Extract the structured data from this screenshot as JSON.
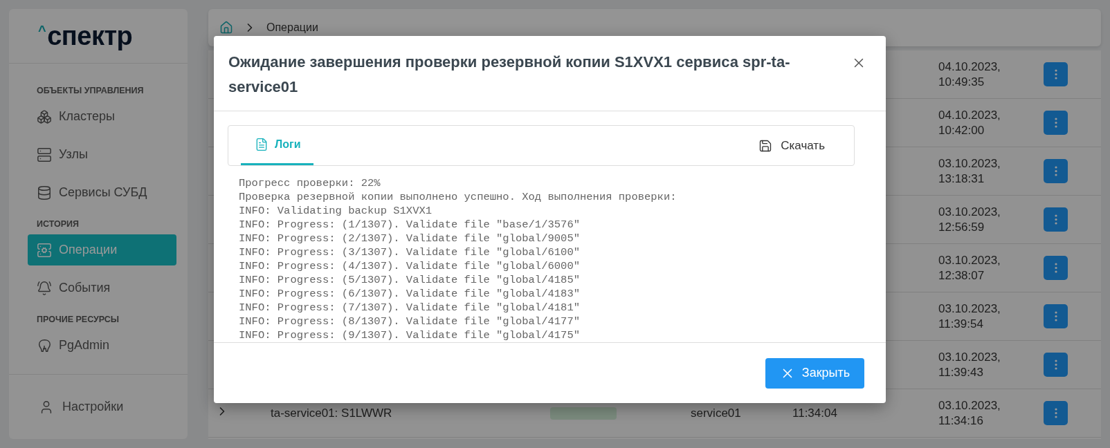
{
  "logo": {
    "mark": "^",
    "name": "спектр"
  },
  "sidebar": {
    "sections": [
      {
        "title": "ОБЪЕКТЫ УПРАВЛЕНИЯ",
        "items": [
          {
            "label": "Кластеры",
            "selected": false
          },
          {
            "label": "Узлы",
            "selected": false
          },
          {
            "label": "Сервисы СУБД",
            "selected": false
          }
        ]
      },
      {
        "title": "ИСТОРИЯ",
        "items": [
          {
            "label": "Операции",
            "selected": true
          },
          {
            "label": "События",
            "selected": false
          }
        ]
      },
      {
        "title": "ПРОЧИЕ РЕСУРСЫ",
        "items": [
          {
            "label": "PgAdmin",
            "selected": false
          }
        ]
      }
    ],
    "footer": {
      "label": "Настройки"
    }
  },
  "breadcrumb": {
    "items": [
      "Операции"
    ]
  },
  "table": {
    "rows": [
      {
        "kind": "partial",
        "date": "04.10.2023, 10:49:35"
      },
      {
        "kind": "partial",
        "date": "04.10.2023, 10:42:00"
      },
      {
        "kind": "partial",
        "date": "03.10.2023, 13:18:31"
      },
      {
        "kind": "partial",
        "date": "03.10.2023, 12:56:59"
      },
      {
        "kind": "partial",
        "date": "03.10.2023, 12:38:07"
      },
      {
        "kind": "partial",
        "date": "03.10.2023, 11:39:54"
      },
      {
        "kind": "partial",
        "date": "03.10.2023, 11:39:43"
      },
      {
        "kind": "full",
        "name": "ta-service01: S1LWWR",
        "service": "service01",
        "started": "11:34:04",
        "date": "03.10.2023, 11:34:16"
      }
    ]
  },
  "modal": {
    "title": "Ожидание завершения проверки резервной копии S1XVX1 сервиса spr-ta-service01",
    "tabs": [
      {
        "label": "Логи",
        "selected": true
      }
    ],
    "download": "Скачать",
    "log_lines": [
      "Прогресс проверки: 22%",
      "Проверка резервной копии выполнено успешно. Ход выполнения проверки:",
      "INFO: Validating backup S1XVX1",
      "INFO: Progress: (1/1307). Validate file \"base/1/3576\"",
      "INFO: Progress: (2/1307). Validate file \"global/9005\"",
      "INFO: Progress: (3/1307). Validate file \"global/6100\"",
      "INFO: Progress: (4/1307). Validate file \"global/6000\"",
      "INFO: Progress: (5/1307). Validate file \"global/4185\"",
      "INFO: Progress: (6/1307). Validate file \"global/4183\"",
      "INFO: Progress: (7/1307). Validate file \"global/4181\"",
      "INFO: Progress: (8/1307). Validate file \"global/4177\"",
      "INFO: Progress: (9/1307). Validate file \"global/4175\""
    ],
    "close_button": "Закрыть"
  }
}
